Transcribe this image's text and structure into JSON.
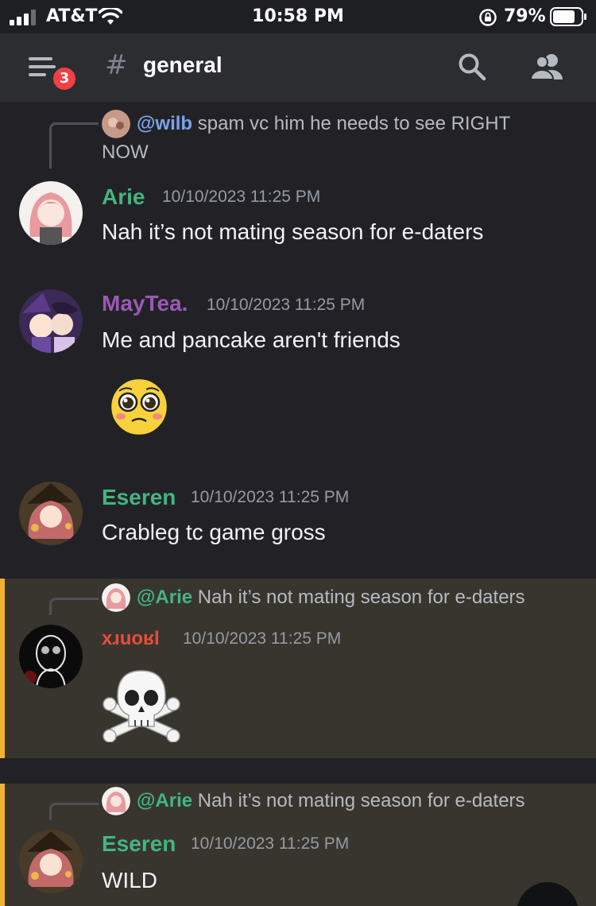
{
  "status_bar": {
    "carrier": "AT&T",
    "time": "10:58 PM",
    "battery_percent": "79%",
    "icons": [
      "signal-icon",
      "wifi-icon",
      "rotation-lock-icon",
      "battery-icon"
    ]
  },
  "header": {
    "unread_badge": "3",
    "hash": "#",
    "channel_name": "general",
    "icons": [
      "menu-icon",
      "search-icon",
      "members-icon"
    ]
  },
  "colors": {
    "highlight_bar": "#f0b232",
    "author_green": "#43b581",
    "author_purple": "#9b59b6",
    "author_red": "#e74c3c",
    "mention_blue": "#7aa2ea"
  },
  "messages": [
    {
      "reply": {
        "mention": "@wilb",
        "text": "spam vc him he needs to see RIGHT",
        "text_line2": "NOW"
      },
      "author": "Arie",
      "timestamp": "10/10/2023 11:25 PM",
      "content": "Nah it’s not mating season for e-daters"
    },
    {
      "author": "MayTea.",
      "timestamp": "10/10/2023 11:25 PM",
      "content": "Me and pancake aren't friends",
      "emoji": "pleading-face-emoji"
    },
    {
      "author": "Eseren",
      "timestamp": "10/10/2023 11:25 PM",
      "content": "Crableg tc game gross"
    },
    {
      "reply": {
        "mention": "@Arie",
        "text": "Nah it’s not mating season for e-daters"
      },
      "author": "xɹuoʁl",
      "timestamp": "10/10/2023 11:25 PM",
      "emoji": "skull-crossbones-emoji"
    },
    {
      "reply": {
        "mention": "@Arie",
        "text": "Nah it’s not mating season for e-daters"
      },
      "author": "Eseren",
      "timestamp": "10/10/2023 11:25 PM",
      "content": "WILD"
    }
  ]
}
